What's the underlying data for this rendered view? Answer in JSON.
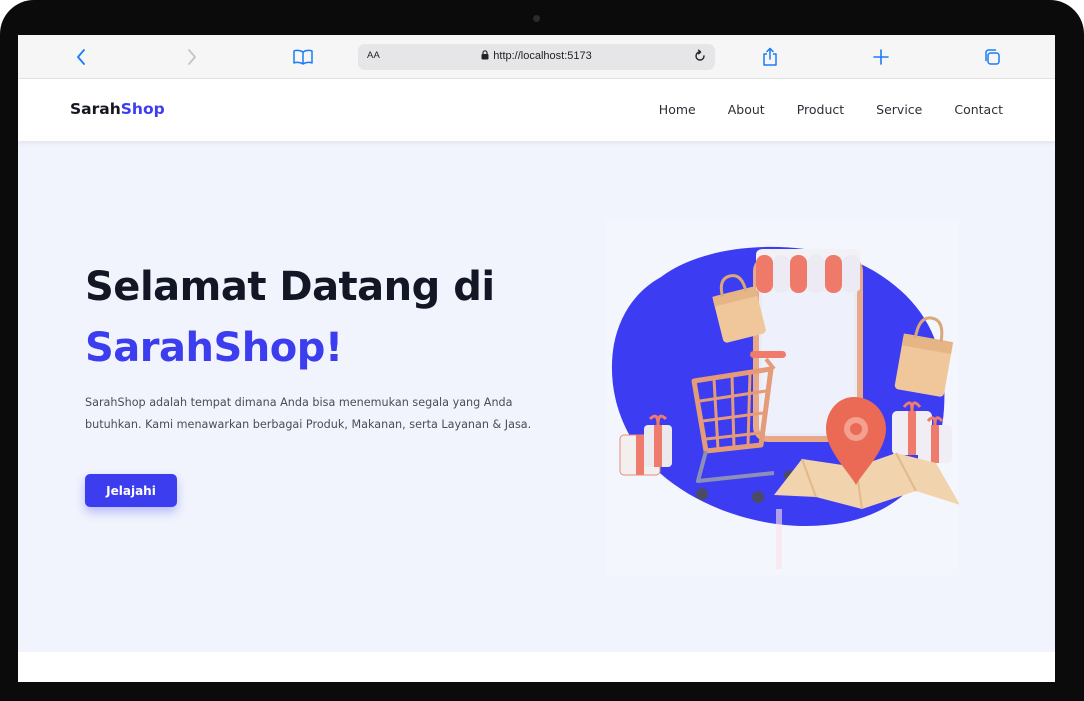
{
  "browser": {
    "address_size_label": "AA",
    "url": "http://localhost:5173",
    "icons": [
      "back-icon",
      "forward-icon",
      "bookmarks-icon",
      "lock-icon",
      "reload-icon",
      "share-icon",
      "new-tab-icon",
      "tabs-icon"
    ]
  },
  "site": {
    "logo": {
      "part1": "Sarah",
      "part2": "Shop"
    },
    "nav": [
      "Home",
      "About",
      "Product",
      "Service",
      "Contact"
    ]
  },
  "hero": {
    "title_line1": "Selamat Datang di",
    "title_line2": "SarahShop!",
    "description": "SarahShop adalah tempat dimana Anda bisa menemukan segala yang Anda butuhkan. Kami menawarkan berbagai Produk, Makanan, serta Layanan & Jasa.",
    "cta_label": "Jelajahi"
  },
  "colors": {
    "accent": "#3d3df0",
    "hero_background": "#f1f4fd",
    "ios_blue": "#1a7cf5",
    "heading": "#121625"
  }
}
